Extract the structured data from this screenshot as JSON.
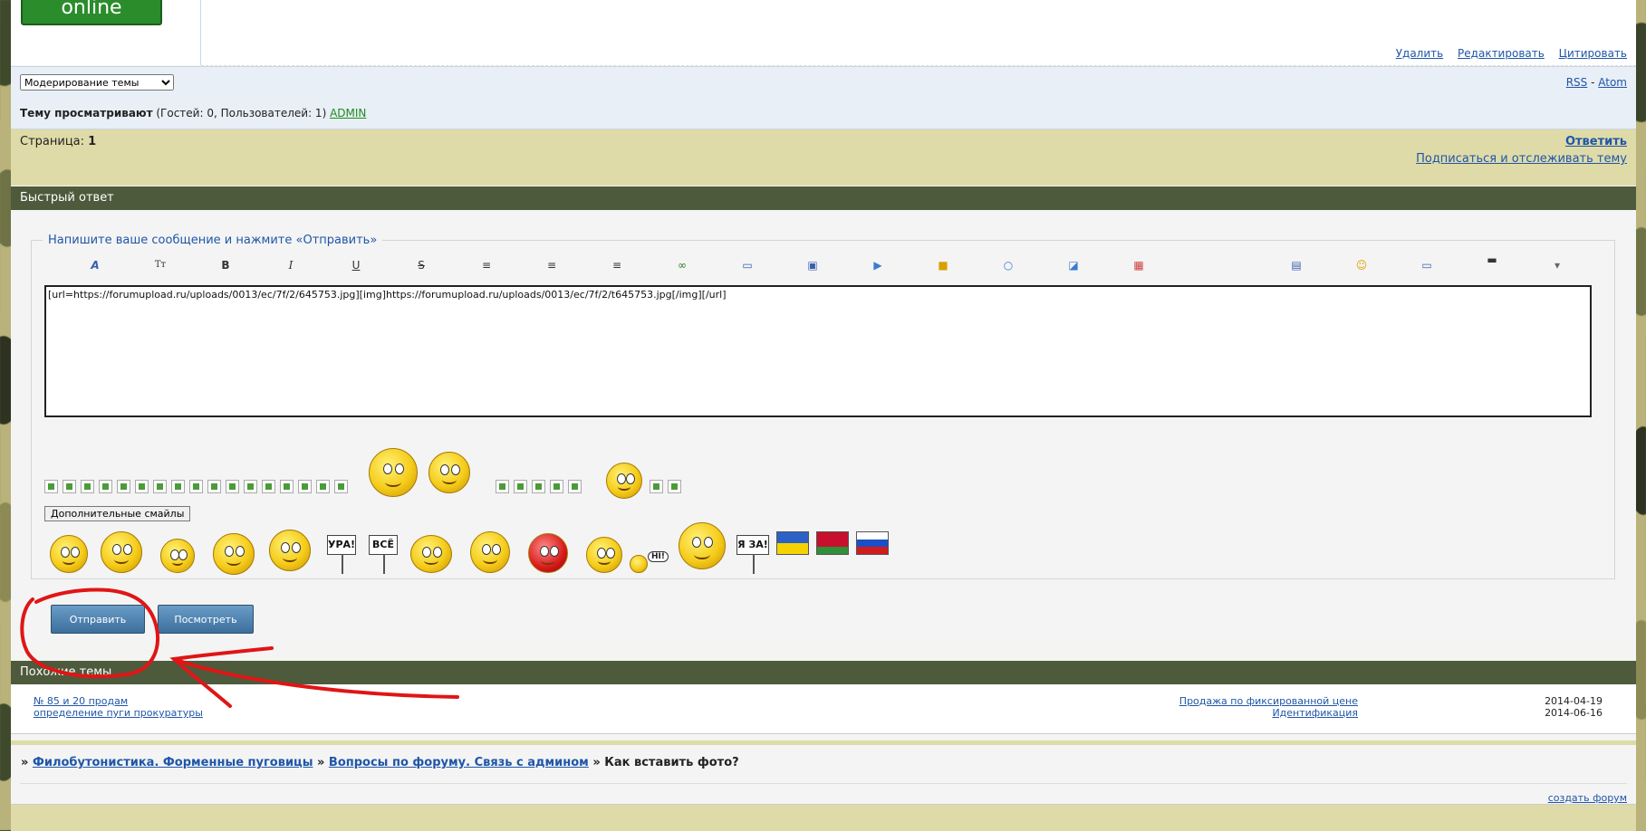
{
  "header": {
    "online_label": "online",
    "post_actions": [
      "Удалить",
      "Редактировать",
      "Цитировать"
    ]
  },
  "moderation": {
    "select_value": "Модерирование темы",
    "rss": "RSS",
    "feed_sep": " - ",
    "atom": "Atom"
  },
  "viewers": {
    "label": "Тему просматривают",
    "counts": " (Гостей: 0, Пользователей: 1) ",
    "user": "ADMIN"
  },
  "pagination": {
    "label": "Страница: ",
    "current": "1",
    "reply": "Ответить",
    "subscribe": "Подписаться и отслеживать тему"
  },
  "quick_reply": {
    "title": "Быстрый ответ",
    "legend": "Напишите ваше сообщение и нажмите «Отправить»",
    "message": "[url=https://forumupload.ru/uploads/0013/ec/7f/2/645753.jpg][img]https://forumupload.ru/uploads/0013/ec/7f/2/t645753.jpg[/img][/url]",
    "more_smilies": "Дополнительные смайлы",
    "signs": [
      "УРА!",
      "ВСЁ",
      "Я ЗА!"
    ],
    "hi_bubble": "HI!",
    "submit": "Отправить",
    "preview": "Посмотреть"
  },
  "toolbar_icons": [
    "font-face-icon",
    "font-size-icon",
    "bold-icon",
    "italic-icon",
    "underline-icon",
    "strike-icon",
    "align-left-icon",
    "align-center-icon",
    "align-right-icon",
    "link-icon",
    "quote-icon",
    "image-icon",
    "video-icon",
    "hide-icon",
    "spoiler-icon",
    "code-icon",
    "color-icon",
    "table-icon",
    "smile-icon",
    "spoiler-box-icon",
    "special-icon",
    "more-icon"
  ],
  "similar": {
    "title": "Похожие темы",
    "topics": [
      {
        "left": "№ 85 и 20 продам",
        "right": "Продажа по фиксированной цене",
        "date": "2014-04-19"
      },
      {
        "left": "определение пуги прокуратуры",
        "right": "Идентификация",
        "date": "2014-06-16"
      }
    ]
  },
  "breadcrumbs": {
    "sep": "» ",
    "forum": "Филобутонистика. Форменные пуговицы",
    "section": "Вопросы по форуму. Связь с админом",
    "current": "Как вставить фото?",
    "create_forum": "создать форум"
  },
  "colors": {
    "link": "#1f56a8",
    "section_head": "#4e5a3c",
    "khaki": "#dfdba8",
    "annotation": "#e01515"
  }
}
